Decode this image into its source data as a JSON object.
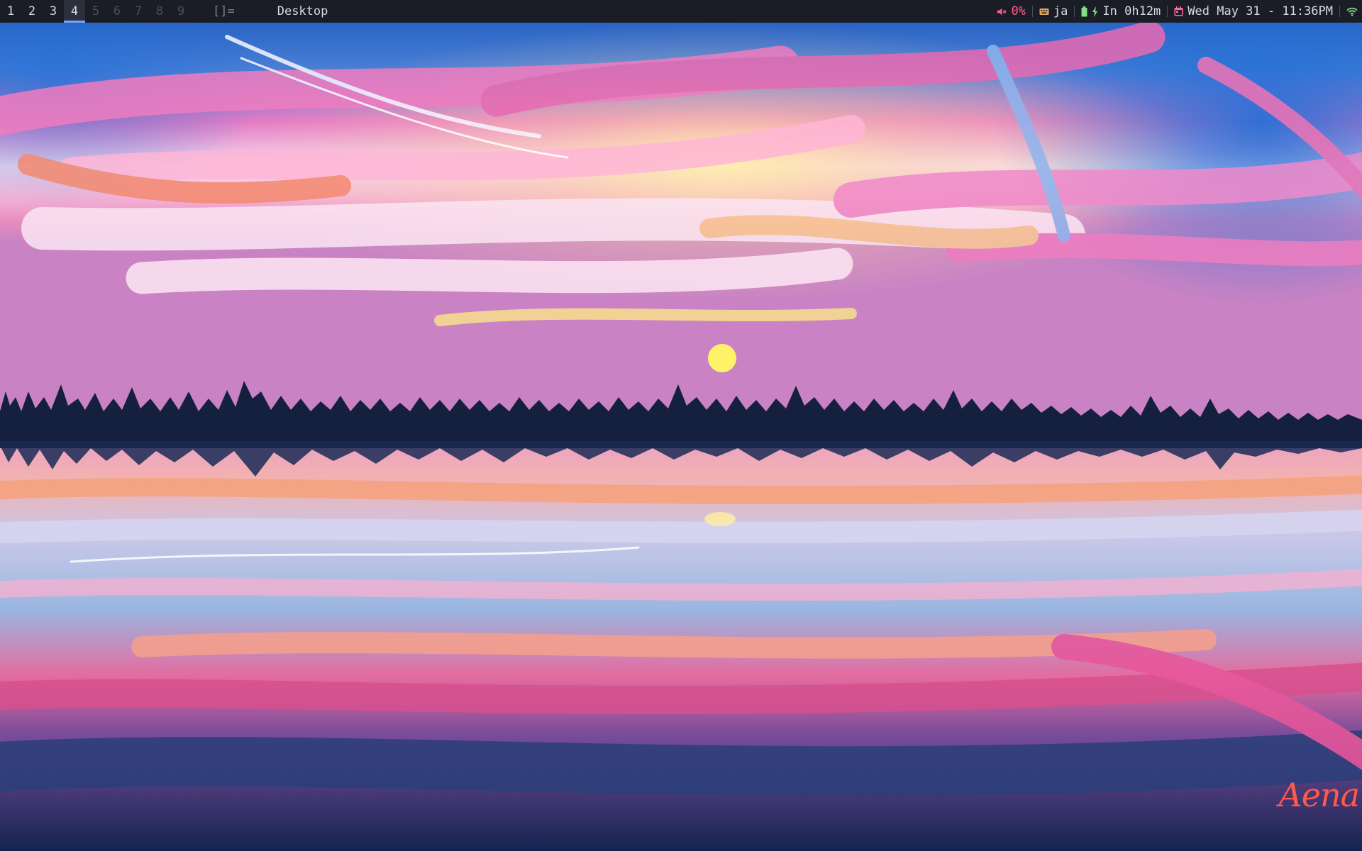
{
  "bar": {
    "tags": [
      {
        "label": "1",
        "state": "occupied"
      },
      {
        "label": "2",
        "state": "occupied"
      },
      {
        "label": "3",
        "state": "occupied"
      },
      {
        "label": "4",
        "state": "active"
      },
      {
        "label": "5",
        "state": "empty"
      },
      {
        "label": "6",
        "state": "empty"
      },
      {
        "label": "7",
        "state": "empty"
      },
      {
        "label": "8",
        "state": "empty"
      },
      {
        "label": "9",
        "state": "empty"
      }
    ],
    "layout_symbol": "[]=",
    "window_title": "Desktop",
    "volume": {
      "icon": "speaker-muted-icon",
      "value": "0%",
      "color": "#ff5c8a"
    },
    "keyboard": {
      "icon": "keyboard-icon",
      "value": "ja",
      "color": "#e0a95c"
    },
    "battery": {
      "icon": "battery-charging-icon",
      "value": "In 0h12m",
      "color": "#7ee07e"
    },
    "clock": {
      "icon": "calendar-icon",
      "value": "Wed May 31 - 11:36PM",
      "color": "#ff6a9a"
    },
    "network": {
      "icon": "wifi-icon",
      "color": "#7ee07e"
    }
  },
  "wallpaper": {
    "description_colors": {
      "sky_pink": "#e874b8",
      "sky_blue": "#2a70c8",
      "sun": "#ffe866",
      "water_navy": "#1a2d5a"
    },
    "signature": "Aena"
  }
}
